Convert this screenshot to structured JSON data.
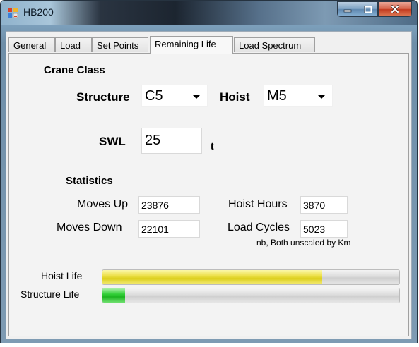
{
  "window": {
    "title": "HB200"
  },
  "tabs": [
    {
      "label": "General",
      "active": false
    },
    {
      "label": "Load",
      "active": false
    },
    {
      "label": "Set Points",
      "active": false
    },
    {
      "label": "Remaining Life",
      "active": true
    },
    {
      "label": "Load Spectrum",
      "active": false
    }
  ],
  "crane_class": {
    "heading": "Crane Class",
    "structure_label": "Structure",
    "structure_value": "C5",
    "hoist_label": "Hoist",
    "hoist_value": "M5"
  },
  "swl": {
    "label": "SWL",
    "value": "25",
    "unit": "t"
  },
  "statistics": {
    "heading": "Statistics",
    "moves_up_label": "Moves Up",
    "moves_up_value": "23876",
    "moves_down_label": "Moves Down",
    "moves_down_value": "22101",
    "hoist_hours_label": "Hoist Hours",
    "hoist_hours_value": "3870",
    "load_cycles_label": "Load Cycles",
    "load_cycles_value": "5023",
    "note": "nb, Both unscaled by Km"
  },
  "life": {
    "hoist_label": "Hoist Life",
    "hoist_fraction": 0.74,
    "structure_label": "Structure Life",
    "structure_fraction": 0.075,
    "hoist_color": "#e4d82a",
    "structure_color": "#2dc832"
  }
}
